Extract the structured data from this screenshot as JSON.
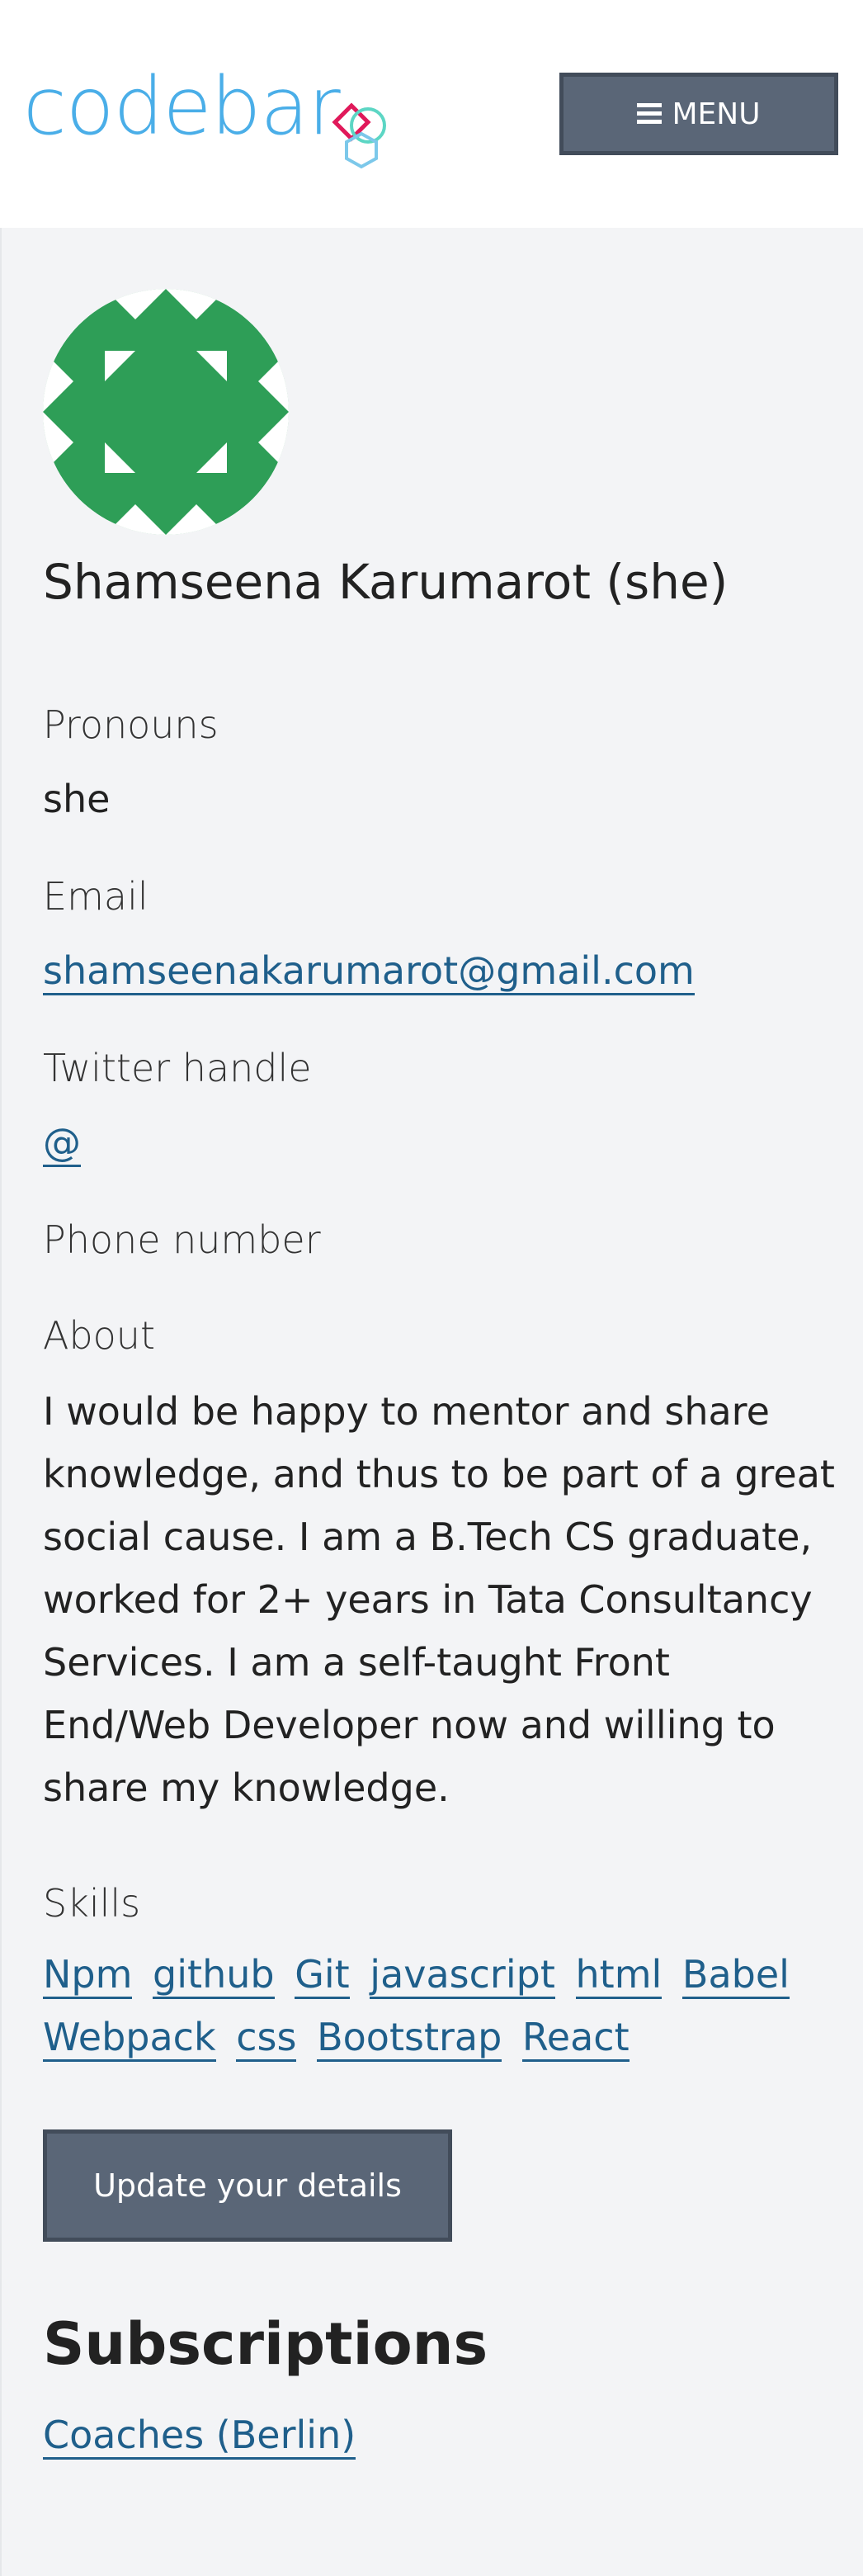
{
  "header": {
    "logo_text": "codebar",
    "menu_label": "MENU"
  },
  "profile": {
    "name": "Shamseena Karumarot (she)",
    "pronouns_label": "Pronouns",
    "pronouns_value": "she",
    "email_label": "Email",
    "email_value": "shamseenakarumarot@gmail.com",
    "twitter_label": "Twitter handle",
    "twitter_value": "@",
    "phone_label": "Phone number",
    "about_label": "About",
    "about_text": "I would be happy to mentor and share knowledge, and thus to be part of a great social cause. I am a B.Tech CS graduate, worked for 2+ years in Tata Consultancy Services. I am a self-taught Front End/Web Developer now and willing to share my knowledge.",
    "skills_label": "Skills",
    "skills": [
      "Npm",
      "github",
      "Git",
      "javascript",
      "html",
      "Babel",
      "Webpack",
      "css",
      "Bootstrap",
      "React"
    ],
    "update_button_label": "Update your details"
  },
  "subscriptions": {
    "title": "Subscriptions",
    "items": [
      "Coaches (Berlin)"
    ]
  },
  "icons": {
    "menu": "hamburger-icon",
    "logo_mark": "codebar-logo-mark-icon",
    "avatar": "identicon-avatar"
  },
  "colors": {
    "brand_blue": "#4aaee8",
    "link": "#1f5f8b",
    "button_bg": "#5a6677",
    "page_bg": "#f3f4f6",
    "avatar_green": "#2e9e57"
  }
}
